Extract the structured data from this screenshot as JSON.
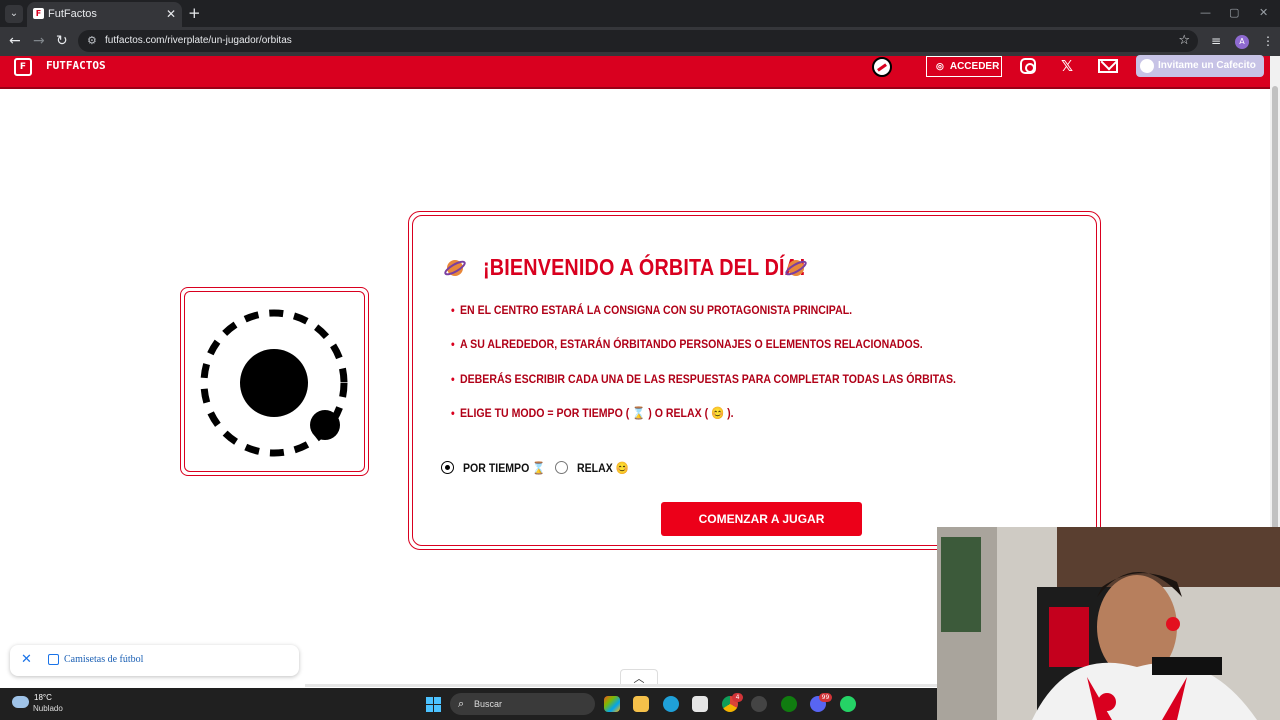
{
  "browser": {
    "tab_title": "FutFactos",
    "tab_close": "✕",
    "new_tab": "+",
    "url": "futfactos.com/riverplate/un-jugador/orbitas",
    "profile_initial": "A"
  },
  "header": {
    "logo_text": "FUTFACTOS",
    "login_label": "ACCEDER",
    "x_glyph": "𝕏",
    "cafecito_label": "Invitame un Cafecito",
    "brand_color": "#d9001f"
  },
  "welcome": {
    "title": "¡BIENVENIDO A ÓRBITA DEL DÍA!",
    "bullets": [
      "EN EL CENTRO ESTARÁ LA CONSIGNA CON SU PROTAGONISTA PRINCIPAL.",
      "A SU ALREDEDOR, ESTARÁN ÓRBITANDO PERSONAJES O ELEMENTOS RELACIONADOS.",
      "DEBERÁS ESCRIBIR CADA UNA DE LAS RESPUESTAS PARA COMPLETAR TODAS LAS ÓRBITAS.",
      "ELIGE TU MODO = POR TIEMPO ( ⌛ ) O RELAX ( 😊 )."
    ],
    "modes": [
      {
        "label": "POR TIEMPO ⌛",
        "selected": true
      },
      {
        "label": "RELAX 😊",
        "selected": false
      }
    ],
    "start_label": "COMENZAR A JUGAR"
  },
  "notification": {
    "text": "Camisetas de fútbol"
  },
  "taskbar": {
    "temperature": "18°C",
    "condition": "Nublado",
    "search_label": "Buscar",
    "badges": [
      "4",
      "99"
    ]
  }
}
